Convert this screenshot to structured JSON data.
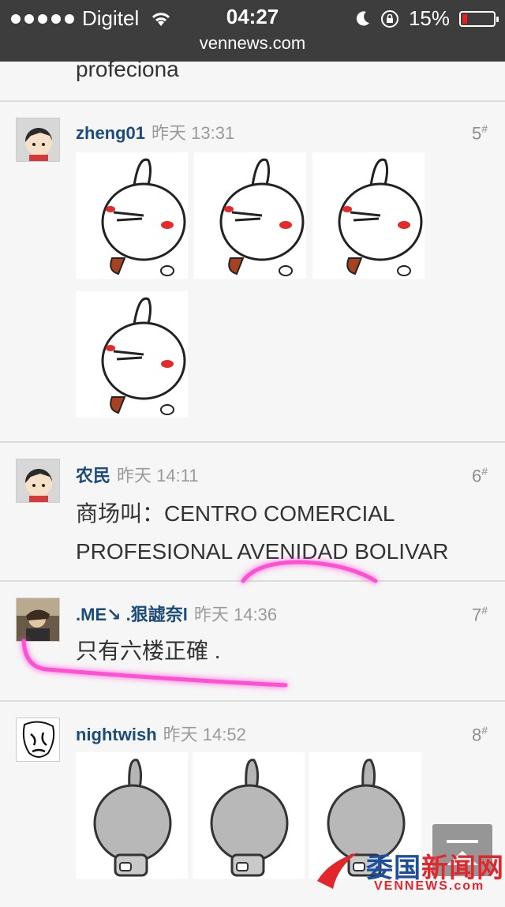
{
  "status_bar": {
    "carrier": "Digitel",
    "time": "04:27",
    "battery_text": "15%",
    "battery_level": 0.15,
    "url": "vennews.com"
  },
  "feed": {
    "truncated_text": "profeciona",
    "posts": [
      {
        "author": "zheng01",
        "time": "昨天 13:31",
        "floor": "5",
        "floor_mark": "#",
        "images": 4,
        "image_style": "white-rabbit"
      },
      {
        "author": "农民",
        "time": "昨天 14:11",
        "floor": "6",
        "floor_mark": "#",
        "content_line1": "商场叫：CENTRO COMERCIAL",
        "content_line2": "PROFESIONAL AVENIDAD BOLIVAR"
      },
      {
        "author": ".ME↘ .狠譃奈l",
        "time": "昨天 14:36",
        "floor": "7",
        "floor_mark": "#",
        "content": "只有六楼正確 ."
      },
      {
        "author": "nightwish",
        "time": "昨天 14:52",
        "floor": "8",
        "floor_mark": "#",
        "images": 3,
        "image_style": "gray-rabbit"
      }
    ]
  },
  "watermark": {
    "brand_blue": "委国",
    "brand_red": "新闻网",
    "site": "VENNEWS.com"
  },
  "colors": {
    "author": "#1b4c7a",
    "highlight": "#ff4fd2",
    "status_bar": "#3d3d3d"
  }
}
